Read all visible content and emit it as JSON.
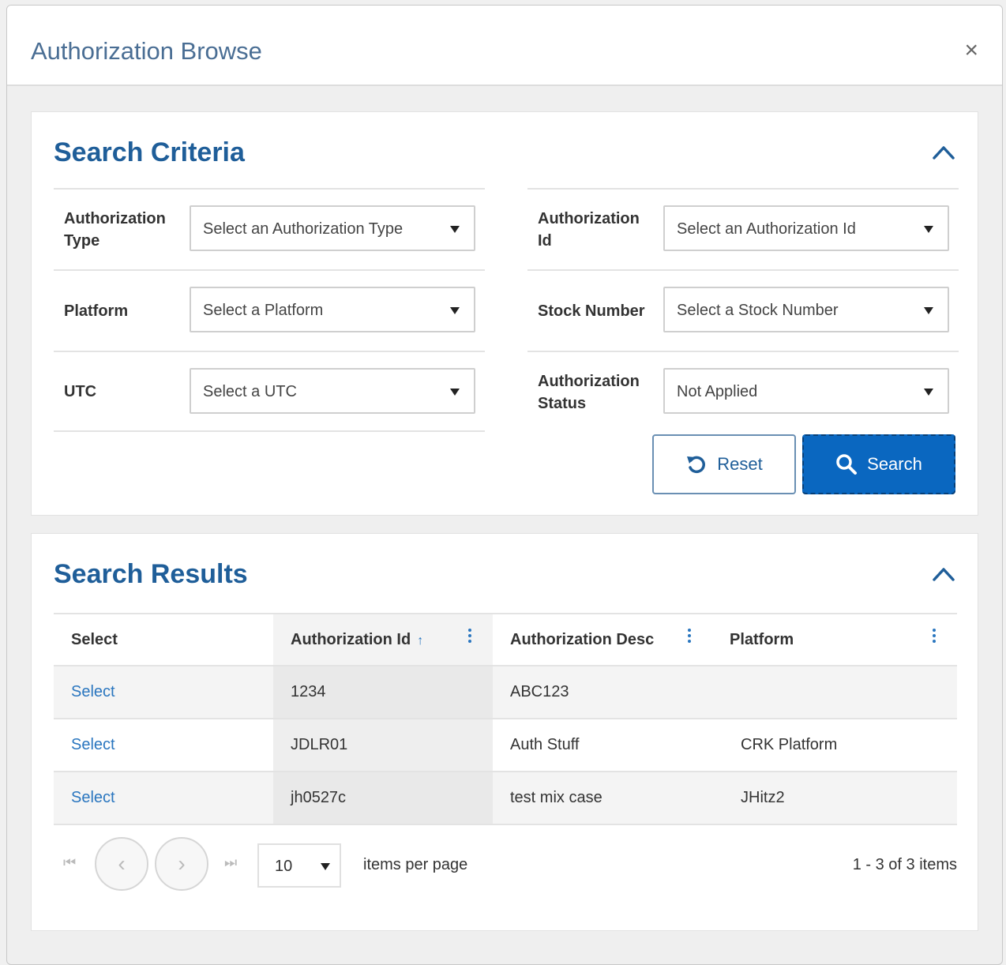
{
  "dialog": {
    "title": "Authorization Browse",
    "close_glyph": "×"
  },
  "criteria": {
    "title": "Search Criteria",
    "fields_left": [
      {
        "label": "Authorization Type",
        "value": "Select an Authorization Type"
      },
      {
        "label": "Platform",
        "value": "Select a Platform"
      },
      {
        "label": "UTC",
        "value": "Select a UTC"
      }
    ],
    "fields_right": [
      {
        "label": "Authorization Id",
        "value": "Select an Authorization Id"
      },
      {
        "label": "Stock Number",
        "value": "Select a Stock Number"
      },
      {
        "label": "Authorization Status",
        "value": "Not Applied"
      }
    ],
    "reset_label": "Reset",
    "search_label": "Search"
  },
  "results": {
    "title": "Search Results",
    "columns": [
      "Select",
      "Authorization Id",
      "Authorization Desc",
      "Platform"
    ],
    "sort_glyph": "↑",
    "rows": [
      {
        "select": "Select",
        "id": "1234",
        "desc": "ABC123",
        "platform": ""
      },
      {
        "select": "Select",
        "id": "JDLR01",
        "desc": "Auth Stuff",
        "platform": "CRK Platform"
      },
      {
        "select": "Select",
        "id": "jh0527c",
        "desc": "test mix case",
        "platform": "JHitz2"
      }
    ]
  },
  "pager": {
    "first_glyph": "⏮",
    "prev_glyph": "‹",
    "next_glyph": "›",
    "last_glyph": "⏭",
    "page_size": "10",
    "per_page_label": "items per page",
    "count_text": "1 - 3 of 3 items"
  },
  "colors": {
    "accent": "#1f5e99",
    "primary_button": "#0a67c0",
    "link": "#2a76bf"
  }
}
